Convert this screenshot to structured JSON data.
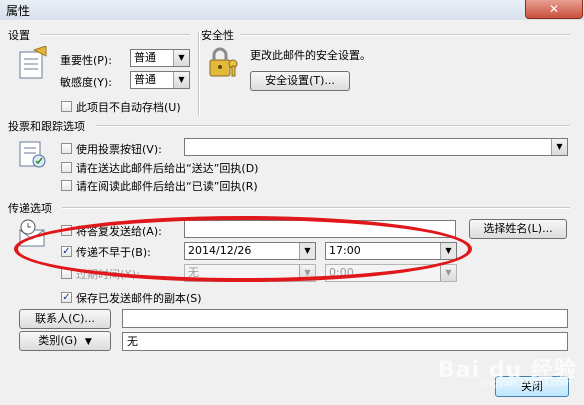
{
  "window": {
    "title": "属性",
    "close_glyph": "✕"
  },
  "settings": {
    "group_label": "设置",
    "importance_label": "重要性(P):",
    "importance_value": "普通",
    "sensitivity_label": "敏感度(Y):",
    "sensitivity_value": "普通",
    "no_autoarchive_label": "此项目不自动存档(U)"
  },
  "security": {
    "group_label": "安全性",
    "description": "更改此邮件的安全设置。",
    "button_label": "安全设置(T)..."
  },
  "voting": {
    "group_label": "投票和跟踪选项",
    "use_voting_label": "使用投票按钮(V):",
    "delivery_receipt_label": "请在送达此邮件后给出“送达”回执(D)",
    "read_receipt_label": "请在阅读此邮件后给出“已读”回执(R)"
  },
  "delivery": {
    "group_label": "传递选项",
    "reply_to_label": "将答复发送给(A):",
    "select_names_label": "选择姓名(L)...",
    "deliver_after_label": "传递不早于(B):",
    "deliver_after_date": "2014/12/26",
    "deliver_after_time": "17:00",
    "expires_label": "过期时间(X):",
    "expires_date": "无",
    "expires_time": "0:00",
    "save_copy_label": "保存已发送邮件的副本(S)"
  },
  "contacts": {
    "button_label": "联系人(C)..."
  },
  "categories": {
    "button_label": "类别(G)",
    "value": "无"
  },
  "footer": {
    "close_label": "关闭"
  },
  "colors": {
    "highlight_oval": "#e0181c",
    "close_button": "#c9503c"
  },
  "watermark": {
    "text": "Bai du 经验",
    "sub": "jingyan.baidu.com"
  }
}
